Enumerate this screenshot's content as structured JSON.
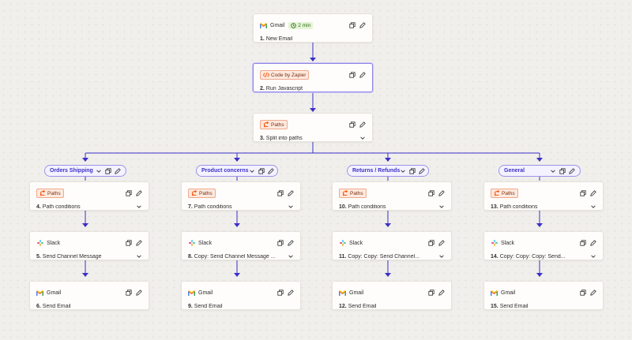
{
  "colors": {
    "wire": "#3b30c9",
    "accent": "#ff4f00",
    "pill_border": "#9a93ea",
    "gmail_red": "#ea4335"
  },
  "steps": {
    "s1": {
      "app": "Gmail",
      "time": "2 min",
      "num": "1.",
      "title": "New Email",
      "icon": "gmail-icon"
    },
    "s2": {
      "app": "Code by Zapier",
      "num": "2.",
      "title": "Run Javascript",
      "icon": "code-icon"
    },
    "s3": {
      "app": "Paths",
      "num": "3.",
      "title": "Split into paths",
      "icon": "paths-icon"
    }
  },
  "branches": [
    {
      "label": "Orders Shipping",
      "steps": [
        {
          "app": "Paths",
          "num": "4.",
          "title": "Path conditions",
          "icon": "paths-icon"
        },
        {
          "app": "Slack",
          "num": "5.",
          "title": "Send Channel Message",
          "icon": "slack-icon"
        },
        {
          "app": "Gmail",
          "num": "6.",
          "title": "Send Email",
          "icon": "gmail-icon"
        }
      ]
    },
    {
      "label": "Product concerns",
      "steps": [
        {
          "app": "Paths",
          "num": "7.",
          "title": "Path conditions",
          "icon": "paths-icon"
        },
        {
          "app": "Slack",
          "num": "8.",
          "title": "Copy: Send Channel Message ...",
          "icon": "slack-icon"
        },
        {
          "app": "Gmail",
          "num": "9.",
          "title": "Send Email",
          "icon": "gmail-icon"
        }
      ]
    },
    {
      "label": "Returns / Refunds",
      "steps": [
        {
          "app": "Paths",
          "num": "10.",
          "title": "Path conditions",
          "icon": "paths-icon"
        },
        {
          "app": "Slack",
          "num": "11.",
          "title": "Copy: Copy: Send Channel...",
          "icon": "slack-icon"
        },
        {
          "app": "Gmail",
          "num": "12.",
          "title": "Send Email",
          "icon": "gmail-icon"
        }
      ]
    },
    {
      "label": "General",
      "steps": [
        {
          "app": "Paths",
          "num": "13.",
          "title": "Path conditions",
          "icon": "paths-icon"
        },
        {
          "app": "Slack",
          "num": "14.",
          "title": "Copy: Copy: Copy: Send...",
          "icon": "slack-icon"
        },
        {
          "app": "Gmail",
          "num": "15.",
          "title": "Send Email",
          "icon": "gmail-icon"
        }
      ]
    }
  ]
}
